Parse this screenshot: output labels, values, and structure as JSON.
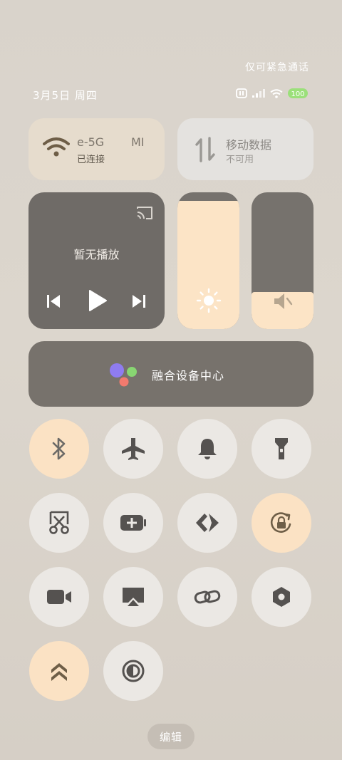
{
  "status": {
    "emergency_text": "仅可紧急通话",
    "date": "3月5日 周四"
  },
  "wifi": {
    "name_left": "e-5G",
    "name_right": "MI",
    "status": "已连接",
    "active": true
  },
  "mobile_data": {
    "title": "移动数据",
    "status": "不可用",
    "active": false
  },
  "media": {
    "title": "暂无播放"
  },
  "brightness": {
    "level_percent": 94
  },
  "volume": {
    "level_percent": 27
  },
  "fusion": {
    "label": "融合设备中心"
  },
  "toggles": [
    {
      "name": "bluetooth",
      "icon": "bluetooth-icon",
      "on": true
    },
    {
      "name": "airplane-mode",
      "icon": "airplane-icon",
      "on": false
    },
    {
      "name": "ring-mode",
      "icon": "bell-icon",
      "on": false
    },
    {
      "name": "flashlight",
      "icon": "flashlight-icon",
      "on": false
    },
    {
      "name": "screenshot",
      "icon": "scissors-icon",
      "on": false
    },
    {
      "name": "battery-saver",
      "icon": "battery-plus-icon",
      "on": false
    },
    {
      "name": "nearby-share",
      "icon": "share-arrow-icon",
      "on": false
    },
    {
      "name": "rotation-lock",
      "icon": "rotation-lock-icon",
      "on": true
    },
    {
      "name": "screen-record",
      "icon": "video-camera-icon",
      "on": false
    },
    {
      "name": "screen-cast",
      "icon": "cast-icon",
      "on": false
    },
    {
      "name": "link",
      "icon": "link-icon",
      "on": false
    },
    {
      "name": "settings",
      "icon": "hexagon-icon",
      "on": false
    },
    {
      "name": "performance-mode",
      "icon": "double-chevron-up-icon",
      "on": true
    },
    {
      "name": "dark-mode",
      "icon": "contrast-icon",
      "on": false
    }
  ],
  "edit_label": "编辑",
  "colors": {
    "accent_on": "#fbe2c4",
    "tile_off": "#ebe8e4",
    "icon_dark": "#555250"
  }
}
